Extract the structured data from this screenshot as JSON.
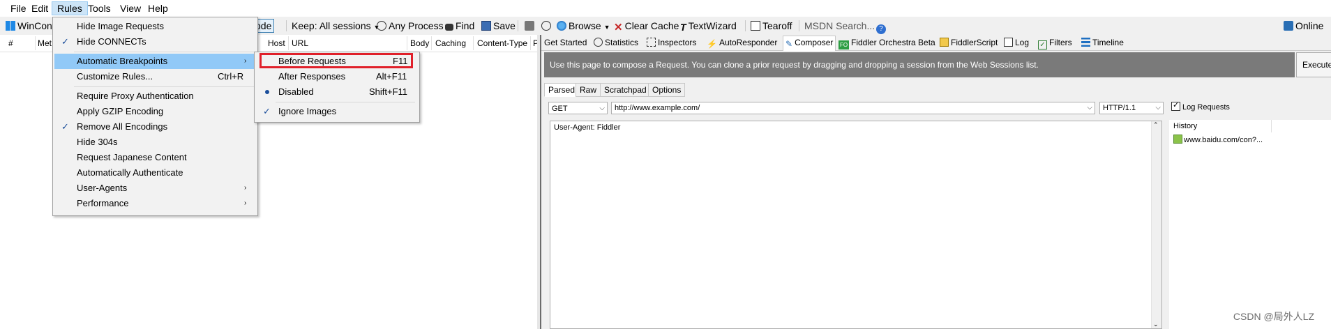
{
  "menubar": {
    "items": [
      "File",
      "Edit",
      "Rules",
      "Tools",
      "View",
      "Help"
    ],
    "active": "Rules"
  },
  "toolbar": {
    "winconfig": "WinConfig",
    "decode": "code",
    "keep": "Keep: All sessions",
    "any_process": "Any Process",
    "find": "Find",
    "save": "Save",
    "browse": "Browse",
    "clear_cache": "Clear Cache",
    "textwizard": "TextWizard",
    "tearoff": "Tearoff",
    "msdn_search": "MSDN Search...",
    "online": "Online"
  },
  "grid": {
    "columns": [
      "#",
      "Met",
      "Host",
      "URL",
      "Body",
      "Caching",
      "Content-Type",
      "P"
    ]
  },
  "rules_menu": {
    "items": [
      {
        "label": "Hide Image Requests",
        "checked": false
      },
      {
        "label": "Hide CONNECTs",
        "checked": true
      },
      {
        "label": "Automatic Breakpoints",
        "submenu": true,
        "highlighted": true
      },
      {
        "label": "Customize Rules...",
        "shortcut": "Ctrl+R"
      },
      {
        "label": "Require Proxy Authentication"
      },
      {
        "label": "Apply GZIP Encoding"
      },
      {
        "label": "Remove All Encodings",
        "checked": true
      },
      {
        "label": "Hide 304s"
      },
      {
        "label": "Request Japanese Content"
      },
      {
        "label": "Automatically Authenticate"
      },
      {
        "label": "User-Agents",
        "submenu": true
      },
      {
        "label": "Performance",
        "submenu": true
      }
    ]
  },
  "breakpoints_menu": {
    "items": [
      {
        "label": "Before Requests",
        "shortcut": "F11"
      },
      {
        "label": "After Responses",
        "shortcut": "Alt+F11"
      },
      {
        "label": "Disabled",
        "shortcut": "Shift+F11",
        "radio": true
      },
      {
        "label": "Ignore Images",
        "checked": true
      }
    ]
  },
  "right_tabs": [
    "Get Started",
    "Statistics",
    "Inspectors",
    "AutoResponder",
    "Composer",
    "Fiddler Orchestra Beta",
    "FiddlerScript",
    "Log",
    "Filters",
    "Timeline"
  ],
  "composer": {
    "banner": "Use this page to compose a Request. You can clone a prior request by dragging and dropping a session from the Web Sessions list.",
    "execute": "Execute",
    "subtabs": [
      "Parsed",
      "Raw",
      "Scratchpad",
      "Options"
    ],
    "method": "GET",
    "url": "http://www.example.com/",
    "http_version": "HTTP/1.1",
    "headers": "User-Agent: Fiddler",
    "log_requests": "Log Requests",
    "history_label": "History",
    "history_items": [
      "www.baidu.com/con?..."
    ]
  },
  "watermark": "CSDN @局外人LZ",
  "colors": {
    "highlight": "#91c9f7",
    "red_box": "#e0202a",
    "banner_bg": "#7a7a7a",
    "check": "#1b4e9b"
  }
}
